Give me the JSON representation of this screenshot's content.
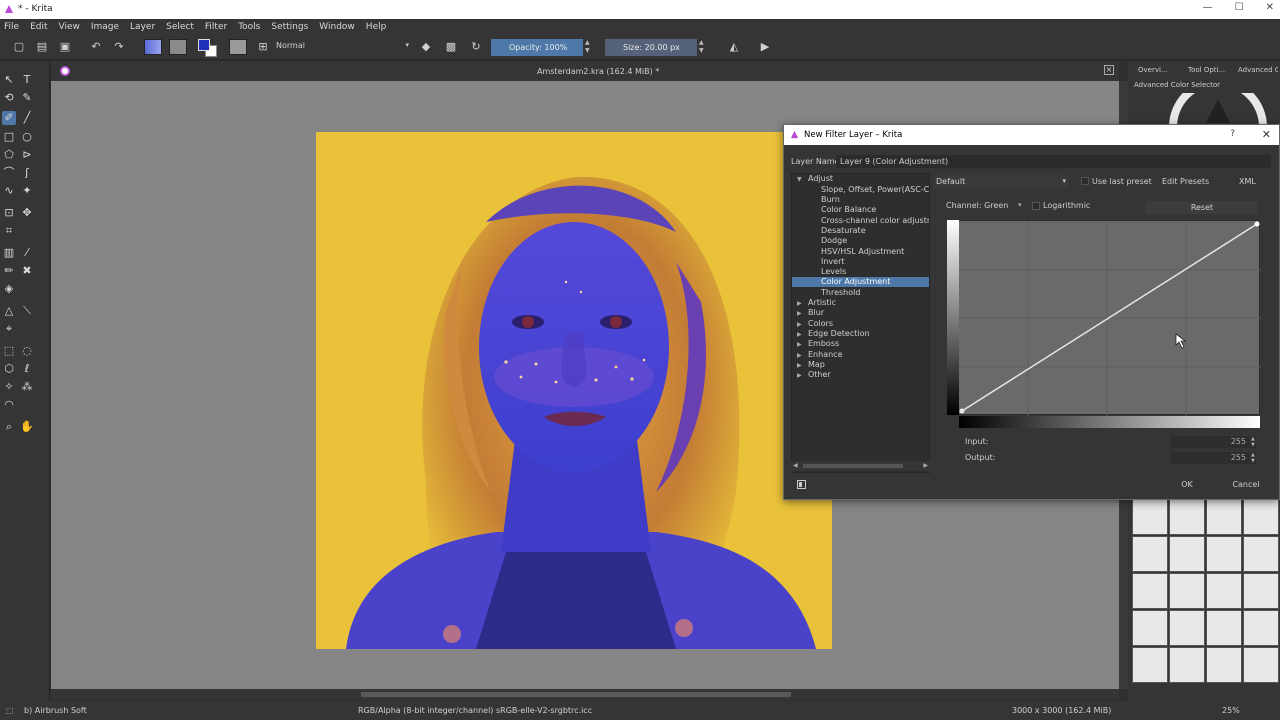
{
  "window": {
    "title": "* - Krita",
    "controls": [
      "—",
      "☐",
      "✕"
    ]
  },
  "menu": [
    "File",
    "Edit",
    "View",
    "Image",
    "Layer",
    "Select",
    "Filter",
    "Tools",
    "Settings",
    "Window",
    "Help"
  ],
  "toolbar": {
    "blend_mode": "Normal",
    "opacity_label": "Opacity:  100%",
    "size_label": "Size:  20.00 px"
  },
  "document": {
    "tab_title": "Amsterdam2.kra (162.4 MiB) *"
  },
  "docker": {
    "tabs": [
      "Overvi...",
      "Tool Opti...",
      "Advanced C..."
    ],
    "subtitle": "Advanced Color Selector"
  },
  "dialog": {
    "title": "New Filter Layer – Krita",
    "help": "?",
    "layer_name_label": "Layer Name:",
    "layer_name_value": "Layer 9 (Color Adjustment)",
    "preset_value": "Default",
    "use_last_preset": "Use last preset",
    "edit_presets": "Edit Presets",
    "xml": "XML",
    "channel_label": "Channel: Green",
    "logarithmic": "Logarithmic",
    "reset": "Reset",
    "input_label": "Input:",
    "input_value": "255",
    "output_label": "Output:",
    "output_value": "255",
    "ok": "OK",
    "cancel": "Cancel",
    "categories": [
      {
        "label": "Adjust",
        "expanded": true,
        "children": [
          "Slope, Offset, Power(ASC-CDL)",
          "Burn",
          "Color Balance",
          "Cross-channel color adjustment",
          "Desaturate",
          "Dodge",
          "HSV/HSL Adjustment",
          "Invert",
          "Levels",
          "Color Adjustment",
          "Threshold"
        ]
      },
      {
        "label": "Artistic"
      },
      {
        "label": "Blur"
      },
      {
        "label": "Colors"
      },
      {
        "label": "Edge Detection"
      },
      {
        "label": "Emboss"
      },
      {
        "label": "Enhance"
      },
      {
        "label": "Map"
      },
      {
        "label": "Other"
      }
    ],
    "selected_filter": "Color Adjustment"
  },
  "status": {
    "brush": "b) Airbrush Soft",
    "color_profile": "RGB/Alpha (8-bit integer/channel)  sRGB-elle-V2-srgbtrc.icc",
    "image_size": "3000 x 3000 (162.4 MiB)",
    "zoom": "25%"
  },
  "colors": {
    "accent": "#4d78a8",
    "background_yellow": "#e9c23a",
    "skin_blue": "#3d3fcf"
  }
}
